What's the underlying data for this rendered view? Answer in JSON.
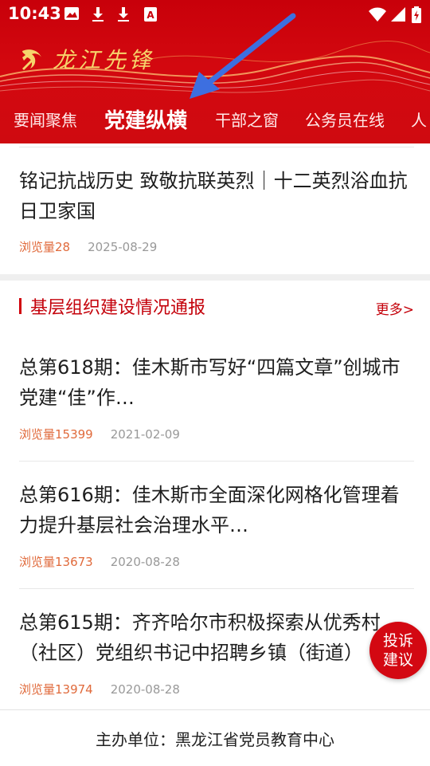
{
  "status_bar": {
    "time": "10:43",
    "left_icons": [
      "image-icon",
      "download-icon",
      "download-icon",
      "a-icon"
    ],
    "right_icons": [
      "wifi-icon",
      "signal-icon",
      "battery-icon"
    ]
  },
  "header": {
    "app_title": "龙江先锋",
    "logo_icon": "party-emblem-icon",
    "colors": {
      "primary": "#d3080f",
      "gold": "#f6d36b"
    }
  },
  "tabs": [
    {
      "label": "要闻聚焦",
      "active": false
    },
    {
      "label": "党建纵横",
      "active": true
    },
    {
      "label": "干部之窗",
      "active": false
    },
    {
      "label": "公务员在线",
      "active": false
    },
    {
      "label": "人",
      "active": false
    }
  ],
  "top_article": {
    "title": "铭记抗战历史 致敬抗联英烈｜十二英烈浴血抗日卫家国",
    "views": "浏览量28",
    "date": "2025-08-29"
  },
  "section": {
    "title": "基层组织建设情况通报",
    "more": "更多>"
  },
  "articles": [
    {
      "title": "总第618期：佳木斯市写好“四篇文章”创城市党建“佳”作…",
      "views": "浏览量15399",
      "date": "2021-02-09"
    },
    {
      "title": "总第616期：佳木斯市全面深化网格化管理着力提升基层社会治理水平…",
      "views": "浏览量13673",
      "date": "2020-08-28"
    },
    {
      "title": "总第615期：齐齐哈尔市积极探索从优秀村（社区）党组织书记中招聘乡镇（街道）",
      "views": "浏览量13974",
      "date": "2020-08-28"
    }
  ],
  "fab": {
    "line1": "投诉",
    "line2": "建议"
  },
  "footer": {
    "text": "主办单位：黑龙江省党员教育中心"
  }
}
